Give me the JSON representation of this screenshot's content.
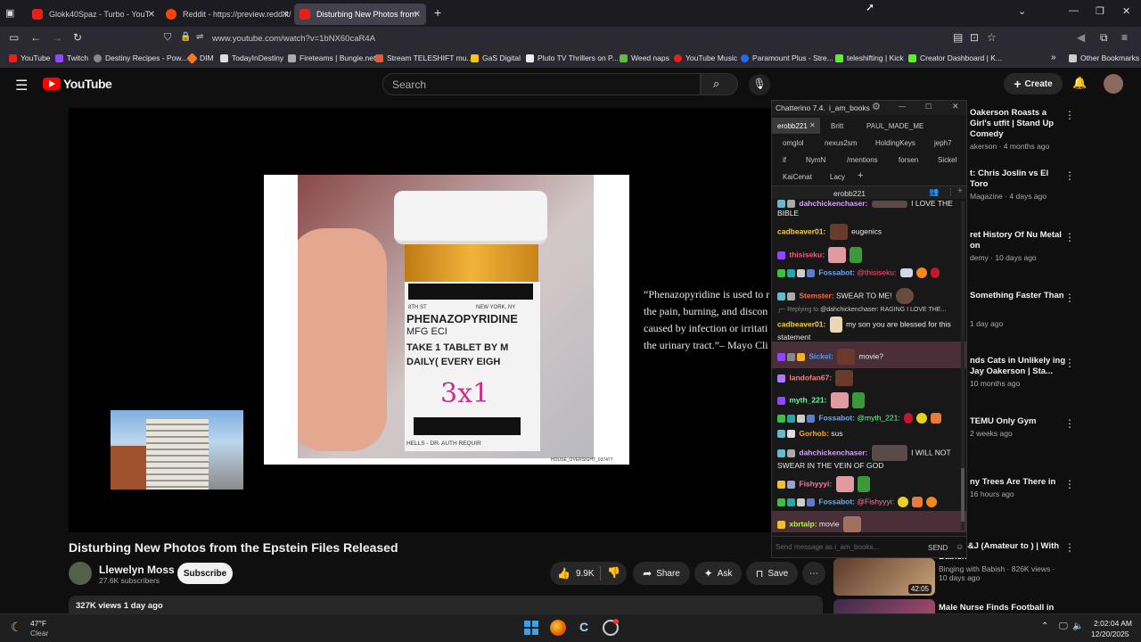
{
  "browser": {
    "tabs": [
      {
        "title": "Glokk40Spaz - Turbo - YouT",
        "color": "#e62117"
      },
      {
        "title": "Reddit - https://preview.redd.it/",
        "color": "#ff4500"
      },
      {
        "title": "Disturbing New Photos from",
        "color": "#e62117"
      }
    ],
    "url": "www.youtube.com/watch?v=1bNX60caR4A",
    "bookmarks": [
      {
        "label": "YouTube",
        "color": "#e62117"
      },
      {
        "label": "Twitch",
        "color": "#9146ff"
      },
      {
        "label": "Destiny Recipes - Pow...",
        "color": "#888888"
      },
      {
        "label": "DIM",
        "color": "#f07a2a"
      },
      {
        "label": "TodayInDestiny",
        "color": "#dddddd"
      },
      {
        "label": "Fireteams | Bungie.net",
        "color": "#aaaaaa"
      },
      {
        "label": "Stream TELESHIFT mu...",
        "color": "#e45b2c"
      },
      {
        "label": "GaS Digital",
        "color": "#f5c518"
      },
      {
        "label": "Pluto TV Thrillers on P...",
        "color": "#eeeeee"
      },
      {
        "label": "Weed naps",
        "color": "#5bbf3a"
      },
      {
        "label": "YouTube Music",
        "color": "#e62117"
      },
      {
        "label": "Paramount Plus - Stre...",
        "color": "#1c6cf2"
      },
      {
        "label": "teleshifting | Kick",
        "color": "#53fc18"
      },
      {
        "label": "Creator Dashboard | K...",
        "color": "#53fc18"
      },
      {
        "label": "Other Bookmarks",
        "color": "#cccccc"
      }
    ]
  },
  "youtube": {
    "logo": "YouTube",
    "search_placeholder": "Search",
    "create_label": "Create",
    "video_title": "Disturbing New Photos from the Epstein Files Released",
    "channel": "Llewelyn Moss",
    "subscribers": "27.6K subscribers",
    "subscribe": "Subscribe",
    "likes": "9.9K",
    "share": "Share",
    "ask": "Ask",
    "save": "Save",
    "views": "327K views  1 day ago"
  },
  "video_frame": {
    "quote": "“Phenazopyridine is used to r the pain, burning, and discon caused by infection or irritati the urinary tract.”– Mayo Cli",
    "quote_lines": [
      "“Phenazopyridine is used to r",
      "the pain, burning, and discon",
      "caused by infection or irritati",
      "the urinary tract.”– Mayo Cli"
    ],
    "label_lines": [
      "PHENAZOPYRIDINE",
      "MFG ECI",
      "TAKE 1 TABLET BY M",
      "DAILY( EVERY EIGH"
    ],
    "label_top": "NEW YORK, NY",
    "label_left": "8TH ST",
    "handwriting": "3x1",
    "label_bottom": "HELLS - DR. AUTH REQUIR",
    "watermark": "HOUSE_OVERSIGHT_037477"
  },
  "chatterino": {
    "title": "Chatterino 7.4.",
    "user": "i_am_books",
    "tabs_row1": [
      "erobb221",
      "Britt",
      "PAUL_MADE_ME"
    ],
    "tabs_row2": [
      "omglol",
      "nexus2sm",
      "HoldingKeys",
      "jeph7"
    ],
    "tabs_row3": [
      "if",
      "NymN",
      "/mentions",
      "forsen",
      "Sickel"
    ],
    "tabs_row4": [
      "KaiCenat",
      "Lacy",
      "+"
    ],
    "channel": "erobb221",
    "messages": [
      {
        "user": "dahchickenchaser:",
        "color": "#d8a0ff",
        "text": "I LOVE THE BIBLE"
      },
      {
        "user": "cadbeaver01:",
        "color": "#ffcc33",
        "text": "eugenics"
      },
      {
        "user": "thisiseku:",
        "color": "#ff5577",
        "text": ""
      },
      {
        "user": "Fossabot:",
        "color": "#66aaff",
        "text": "@thisiseku:"
      },
      {
        "user": "Stemster:",
        "color": "#ff6b3d",
        "text": "SWEAR TO ME!"
      },
      {
        "user": "Replying to",
        "color": "#888888",
        "text": "@dahchickenchaser: RAGING I LOVE THE..."
      },
      {
        "user": "cadbeaver01:",
        "color": "#ffcc33",
        "text": "my son you are blessed for this statement"
      },
      {
        "user": "Sickel:",
        "color": "#3fa2ff",
        "text": "movie?"
      },
      {
        "user": "landofan67:",
        "color": "#ff7c7c",
        "text": ""
      },
      {
        "user": "myth_221:",
        "color": "#66ff99",
        "text": ""
      },
      {
        "user": "Fossabot:",
        "color": "#66aaff",
        "text": "@myth_221:"
      },
      {
        "user": "Gorhob:",
        "color": "#ffaa00",
        "text": "sus"
      },
      {
        "user": "dahchickenchaser:",
        "color": "#d8a0ff",
        "text": "I WILL NOT SWEAR IN THE VEIN OF GOD"
      },
      {
        "user": "Fishyyyi:",
        "color": "#ff77aa",
        "text": ""
      },
      {
        "user": "Fossabot:",
        "color": "#66aaff",
        "text": "@Fishyyyi:"
      },
      {
        "user": "xbrtalp:",
        "color": "#b0ff3c",
        "text": "movie"
      }
    ],
    "input_placeholder": "Send message as i_am_books...",
    "send": "SEND"
  },
  "recommendations": [
    {
      "title": "Oakerson Roasts a Girl's utfit | Stand Up Comedy",
      "meta": "akerson · 4 months ago"
    },
    {
      "title": "t: Chris Joslin vs El Toro",
      "meta": "Magazine · 4 days ago"
    },
    {
      "title": "ret History Of Nu Metal on",
      "meta": "demy · 10 days ago"
    },
    {
      "title": "Something Faster Than",
      "meta": "1 day ago"
    },
    {
      "title": "nds Cats in Unlikely ing Jay Oakerson | Sta...",
      "meta": "10 months ago"
    },
    {
      "title": "TEMU Only Gym",
      "meta": "2 weeks ago"
    },
    {
      "title": "ny Trees Are There in",
      "meta": "16 hours ago"
    },
    {
      "title": "s of PB&J (Amateur to ) | With Babish",
      "meta": "Binging with Babish · 826K views · 10 days ago",
      "duration": "42:05"
    },
    {
      "title": "Male Nurse Finds Football in",
      "meta": ""
    }
  ],
  "taskbar": {
    "weather_temp": "47°F",
    "weather_desc": "Clear",
    "time": "2:02:04 AM",
    "date": "12/20/2025"
  }
}
